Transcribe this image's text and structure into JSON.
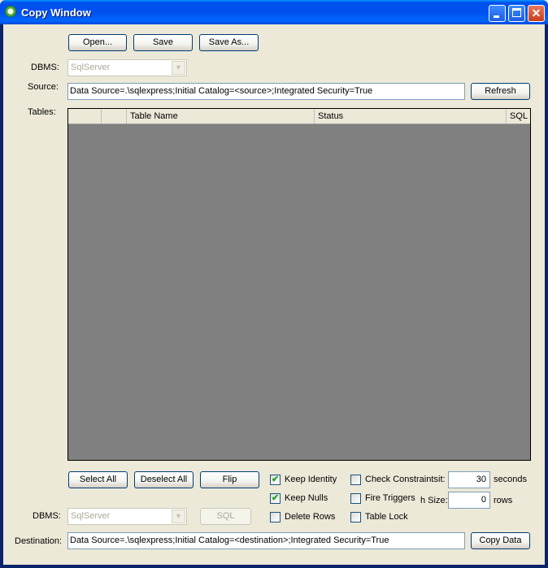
{
  "window": {
    "title": "Copy Window",
    "app_icon": "recycle-icon"
  },
  "toolbar": {
    "open_label": "Open...",
    "save_label": "Save",
    "save_as_label": "Save As..."
  },
  "source": {
    "dbms_label": "DBMS:",
    "dbms_value": "SqlServer",
    "source_label": "Source:",
    "connection_string": "Data Source=.\\sqlexpress;Initial Catalog=<source>;Integrated Security=True",
    "refresh_label": "Refresh"
  },
  "tables": {
    "label": "Tables:",
    "columns": [
      "",
      "",
      "Table Name",
      "Status",
      "SQL"
    ],
    "rows": []
  },
  "selection": {
    "select_all": "Select All",
    "deselect_all": "Deselect All",
    "flip": "Flip"
  },
  "options": {
    "keep_identity": {
      "label": "Keep Identity",
      "checked": true
    },
    "keep_nulls": {
      "label": "Keep Nulls",
      "checked": true
    },
    "delete_rows": {
      "label": "Delete Rows",
      "checked": false
    },
    "check_constraints": {
      "label": "Check Constraints",
      "checked": false
    },
    "fire_triggers": {
      "label": "Fire Triggers",
      "checked": false
    },
    "table_lock": {
      "label": "Table Lock",
      "checked": false
    },
    "timeout_label": "it:",
    "timeout_value": "30",
    "timeout_unit": "seconds",
    "batch_label": "h Size:",
    "batch_value": "0",
    "batch_unit": "rows"
  },
  "destination": {
    "dbms_label": "DBMS:",
    "dbms_value": "SqlServer",
    "sql_label": "SQL",
    "destination_label": "Destination:",
    "connection_string": "Data Source=.\\sqlexpress;Initial Catalog=<destination>;Integrated Security=True",
    "copy_label": "Copy Data"
  }
}
